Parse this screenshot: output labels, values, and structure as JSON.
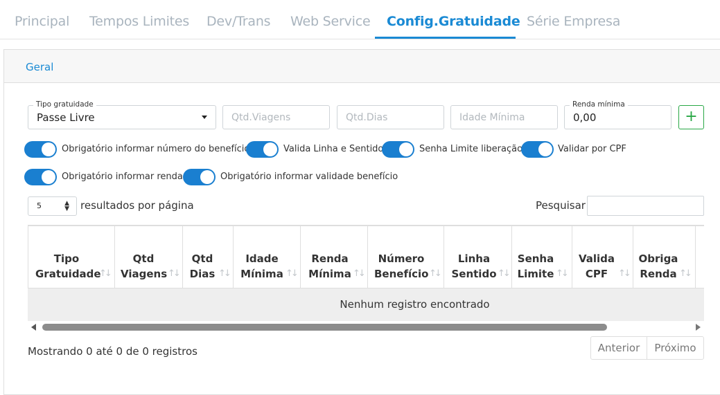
{
  "tabs": [
    {
      "label": "Principal",
      "active": false
    },
    {
      "label": "Tempos Limites",
      "active": false
    },
    {
      "label": "Dev/Trans",
      "active": false
    },
    {
      "label": "Web Service",
      "active": false
    },
    {
      "label": "Config.Gratuidade",
      "active": true
    },
    {
      "label": "Série Empresa",
      "active": false
    }
  ],
  "panel": {
    "header": "Geral"
  },
  "form": {
    "tipo_gratuidade": {
      "label": "Tipo gratuidade",
      "value": "Passe Livre"
    },
    "qtd_viagens": {
      "placeholder": "Qtd.Viagens"
    },
    "qtd_dias": {
      "placeholder": "Qtd.Dias"
    },
    "idade_minima": {
      "placeholder": "Idade Mínima"
    },
    "renda_minima": {
      "label": "Renda mínima",
      "value": "0,00"
    },
    "add_button": "+"
  },
  "toggles": [
    {
      "label": "Obrigatório informar número do benefício",
      "on": true
    },
    {
      "label": "Valida Linha e Sentido",
      "on": true
    },
    {
      "label": "Senha Limite liberação",
      "on": true
    },
    {
      "label": "Validar por CPF",
      "on": true
    },
    {
      "label": "Obrigatório informar renda",
      "on": true
    },
    {
      "label": "Obrigatório informar validade benefício",
      "on": true
    }
  ],
  "table_controls": {
    "page_length": "5",
    "page_length_text": "resultados por página",
    "search_label": "Pesquisar"
  },
  "table": {
    "columns": [
      {
        "line1": "Tipo",
        "line2": "Gratuidade"
      },
      {
        "line1": "Qtd",
        "line2": "Viagens"
      },
      {
        "line1": "Qtd",
        "line2": "Dias"
      },
      {
        "line1": "Idade",
        "line2": "Mínima"
      },
      {
        "line1": "Renda",
        "line2": "Mínima"
      },
      {
        "line1": "Número",
        "line2": "Benefício"
      },
      {
        "line1": "Linha",
        "line2": "Sentido"
      },
      {
        "line1": "Senha",
        "line2": "Limite"
      },
      {
        "line1": "Valida",
        "line2": "CPF"
      },
      {
        "line1": "Obriga",
        "line2": "Renda"
      }
    ],
    "sort_icon": "↑↓",
    "empty_message": "Nenhum registro encontrado"
  },
  "footer": {
    "info": "Mostrando 0 até 0 de 0 registros",
    "prev": "Anterior",
    "next": "Próximo"
  },
  "colors": {
    "accent": "#1a8ad4",
    "toggle_on": "#1a7fd0",
    "add_button": "#28a745"
  }
}
